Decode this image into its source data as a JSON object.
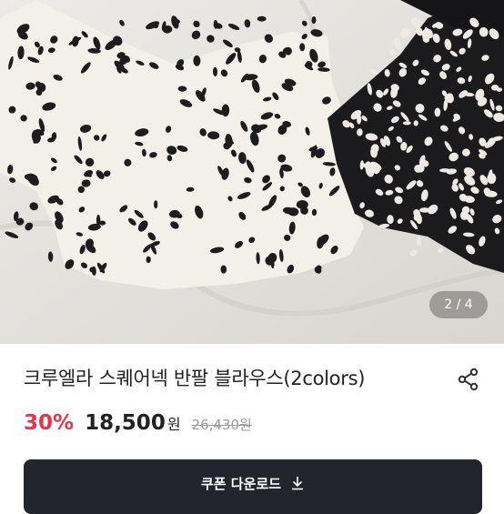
{
  "gallery": {
    "pager_text": "2 / 4",
    "image_alt": "product-photo-leopard-print-blouses"
  },
  "product": {
    "title": "크루엘라 스퀘어넥 반팔 블라우스(2colors)",
    "discount": "30%",
    "price": "18,500",
    "price_unit": "원",
    "original_price": "26,430원"
  },
  "actions": {
    "share_icon": "share-icon",
    "coupon_label": "쿠폰 다운로드",
    "coupon_icon": "download-icon"
  },
  "colors": {
    "discount": "#e8334a",
    "button_bg": "#23252c"
  }
}
